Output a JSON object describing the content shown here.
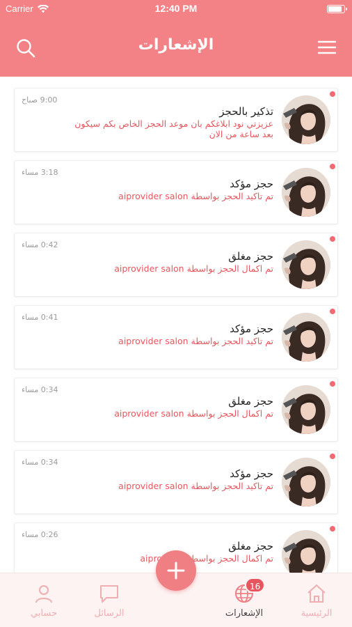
{
  "status_bar": {
    "carrier": "Carrier",
    "time": "12:40 PM",
    "battery_level": 0.9
  },
  "header": {
    "title": "الإشعارات",
    "search_icon": "search-icon",
    "menu_icon": "menu-icon"
  },
  "notifications": [
    {
      "title": "تذكير بالحجز",
      "body": "عزيزتي نود ابلاغكم بان موعد الحجز الخاص بكم سيكون بعد ساعة من الان",
      "time": "9:00 صباح",
      "unread": true
    },
    {
      "title": "حجز مؤكد",
      "body": "تم تاكيد الحجز بواسطة aiprovider salon",
      "time": "3:18 مساء",
      "unread": true
    },
    {
      "title": "حجز مغلق",
      "body": "تم اكمال الحجز بواسطة aiprovider salon",
      "time": "0:42 مساء",
      "unread": true
    },
    {
      "title": "حجز مؤكد",
      "body": "تم تاكيد الحجز بواسطة aiprovider salon",
      "time": "0:41 مساء",
      "unread": true
    },
    {
      "title": "حجز مغلق",
      "body": "تم اكمال الحجز بواسطة aiprovider salon",
      "time": "0:34 مساء",
      "unread": true
    },
    {
      "title": "حجز مؤكد",
      "body": "تم تاكيد الحجز بواسطة aiprovider salon",
      "time": "0:34 مساء",
      "unread": true
    },
    {
      "title": "حجز مغلق",
      "body": "تم اكمال الحجز بواسطة aiprovider",
      "time": "0:26 مساء",
      "unread": true
    }
  ],
  "tabbar": {
    "home": {
      "label": "الرئيسية",
      "icon": "home-icon"
    },
    "notifications": {
      "label": "الإشعارات",
      "icon": "globe-icon",
      "badge": "16"
    },
    "messages": {
      "label": "الرسائل",
      "icon": "chat-icon"
    },
    "account": {
      "label": "حسابي",
      "icon": "user-icon"
    },
    "fab": {
      "icon": "plus-icon"
    }
  },
  "colors": {
    "brand": "#f28286",
    "accent_text": "#e8555e",
    "unread_dot": "#f26b72",
    "tab_inactive": "#f0aeb1"
  }
}
